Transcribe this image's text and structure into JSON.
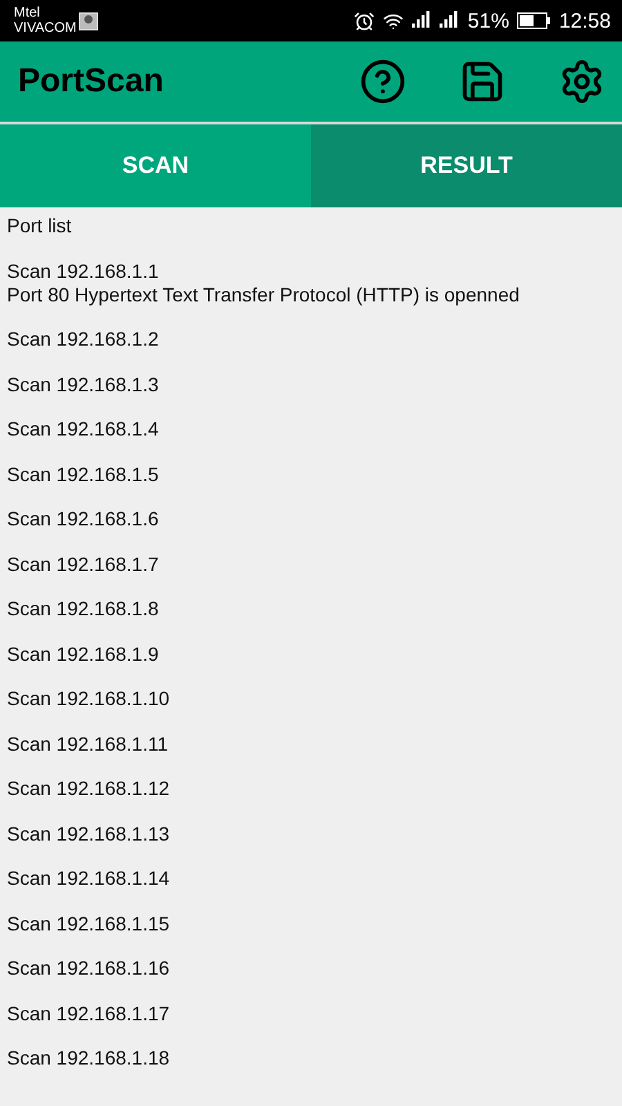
{
  "status_bar": {
    "carriers": [
      "Mtel",
      "VIVACOM"
    ],
    "battery": "51%",
    "time": "12:58"
  },
  "app_bar": {
    "title": "PortScan"
  },
  "tabs": [
    {
      "label": "SCAN",
      "selected": false
    },
    {
      "label": "RESULT",
      "selected": true
    }
  ],
  "result": {
    "heading": "Port list",
    "entries": [
      {
        "title": "Scan 192.168.1.1",
        "details": [
          "Port 80 Hypertext Text Transfer Protocol (HTTP) is openned"
        ]
      },
      {
        "title": "Scan 192.168.1.2"
      },
      {
        "title": "Scan 192.168.1.3"
      },
      {
        "title": "Scan 192.168.1.4"
      },
      {
        "title": "Scan 192.168.1.5"
      },
      {
        "title": "Scan 192.168.1.6"
      },
      {
        "title": "Scan 192.168.1.7"
      },
      {
        "title": "Scan 192.168.1.8"
      },
      {
        "title": "Scan 192.168.1.9"
      },
      {
        "title": "Scan 192.168.1.10"
      },
      {
        "title": "Scan 192.168.1.11"
      },
      {
        "title": "Scan 192.168.1.12"
      },
      {
        "title": "Scan 192.168.1.13"
      },
      {
        "title": "Scan 192.168.1.14"
      },
      {
        "title": "Scan 192.168.1.15"
      },
      {
        "title": "Scan 192.168.1.16"
      },
      {
        "title": "Scan 192.168.1.17"
      },
      {
        "title": "Scan 192.168.1.18"
      }
    ]
  }
}
